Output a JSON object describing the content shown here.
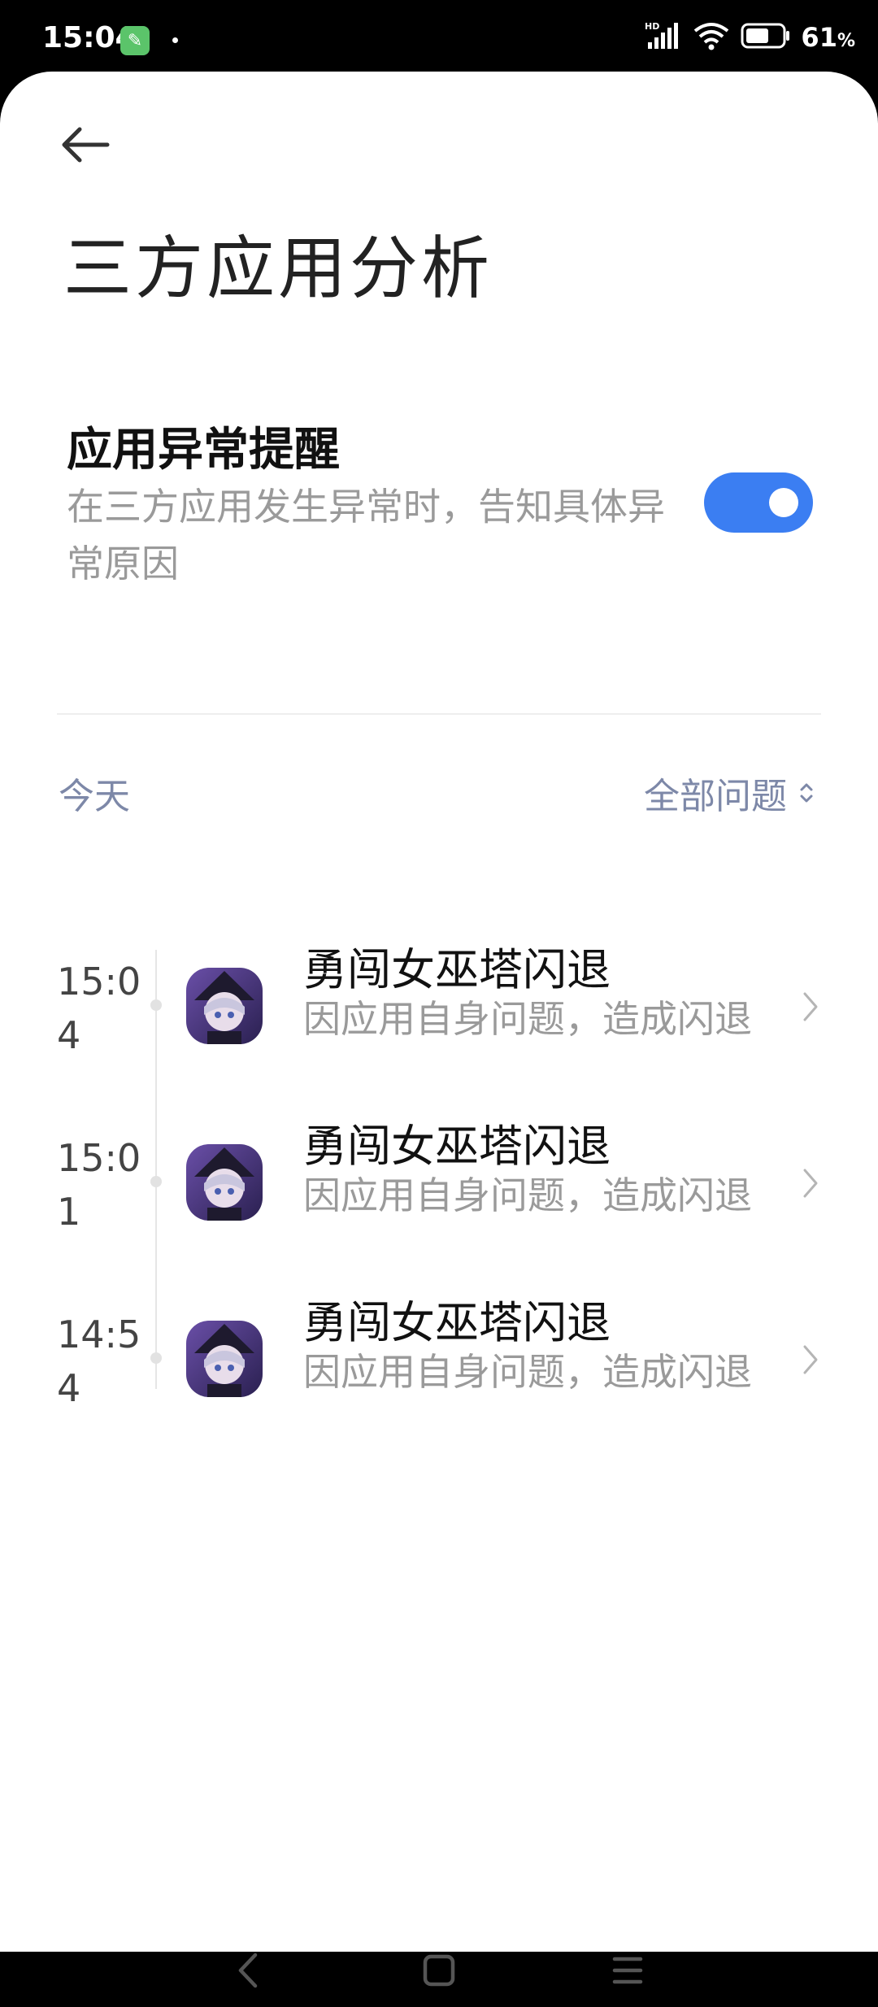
{
  "status_bar": {
    "time": "15:04",
    "network_label": "HD",
    "battery_percent": "61",
    "battery_unit": "%"
  },
  "header": {
    "title": "三方应用分析"
  },
  "setting": {
    "title": "应用异常提醒",
    "description": "在三方应用发生异常时，告知具体异常原因",
    "toggle_on": true
  },
  "section": {
    "date_label": "今天",
    "filter_label": "全部问题"
  },
  "records": [
    {
      "time": "15:04",
      "app_name": "勇闯女巫塔闪退",
      "reason": "因应用自身问题，造成闪退"
    },
    {
      "time": "15:01",
      "app_name": "勇闯女巫塔闪退",
      "reason": "因应用自身问题，造成闪退"
    },
    {
      "time": "14:54",
      "app_name": "勇闯女巫塔闪退",
      "reason": "因应用自身问题，造成闪退"
    }
  ],
  "colors": {
    "accent": "#3b7ef2",
    "secondary_text": "#9a9a9a",
    "section_text": "#7d88a8"
  }
}
